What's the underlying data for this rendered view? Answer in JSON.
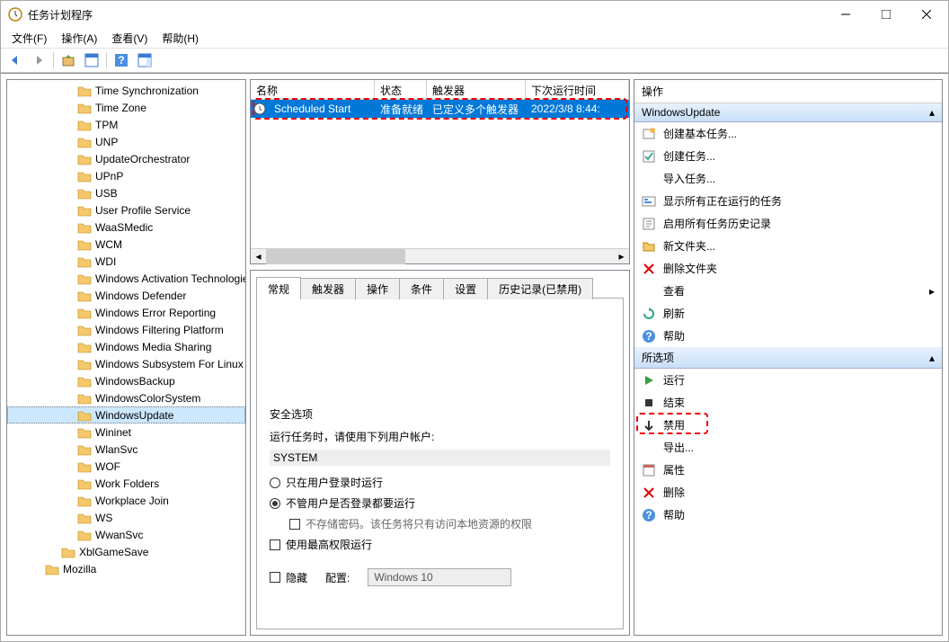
{
  "window": {
    "title": "任务计划程序"
  },
  "menu": {
    "file": "文件(F)",
    "action": "操作(A)",
    "view": "查看(V)",
    "help": "帮助(H)"
  },
  "tree": {
    "items": [
      "Time Synchronization",
      "Time Zone",
      "TPM",
      "UNP",
      "UpdateOrchestrator",
      "UPnP",
      "USB",
      "User Profile Service",
      "WaaSMedic",
      "WCM",
      "WDI",
      "Windows Activation Technologies",
      "Windows Defender",
      "Windows Error Reporting",
      "Windows Filtering Platform",
      "Windows Media Sharing",
      "Windows Subsystem For Linux",
      "WindowsBackup",
      "WindowsColorSystem",
      "WindowsUpdate",
      "Wininet",
      "WlanSvc",
      "WOF",
      "Work Folders",
      "Workplace Join",
      "WS",
      "WwanSvc"
    ],
    "parent1": "XblGameSave",
    "parent0": "Mozilla",
    "selected": "WindowsUpdate"
  },
  "list": {
    "cols": {
      "name": "名称",
      "status": "状态",
      "trigger": "触发器",
      "next": "下次运行时间"
    },
    "row": {
      "name": "Scheduled Start",
      "status": "准备就绪",
      "trigger": "已定义多个触发器",
      "next": "2022/3/8 8:44:"
    }
  },
  "tabs": {
    "general": "常规",
    "triggers": "触发器",
    "actions": "操作",
    "conditions": "条件",
    "settings": "设置",
    "history": "历史记录(已禁用)"
  },
  "security": {
    "title": "安全选项",
    "runAs": "运行任务时，请使用下列用户帐户:",
    "account": "SYSTEM",
    "onlyLoggedIn": "只在用户登录时运行",
    "anyLogin": "不管用户是否登录都要运行",
    "noStore": "不存储密码。该任务将只有访问本地资源的权限",
    "highest": "使用最高权限运行",
    "hidden": "隐藏",
    "configLabel": "配置:",
    "configValue": "Windows 10"
  },
  "actions": {
    "header": "操作",
    "section1": "WindowsUpdate",
    "createBasic": "创建基本任务...",
    "createTask": "创建任务...",
    "importTask": "导入任务...",
    "showRunning": "显示所有正在运行的任务",
    "enableHistory": "启用所有任务历史记录",
    "newFolder": "新文件夹...",
    "deleteFolder": "删除文件夹",
    "view": "查看",
    "refresh": "刷新",
    "help": "帮助",
    "section2": "所选项",
    "run": "运行",
    "end": "结束",
    "disable": "禁用",
    "export": "导出...",
    "properties": "属性",
    "delete": "删除",
    "help2": "帮助"
  }
}
